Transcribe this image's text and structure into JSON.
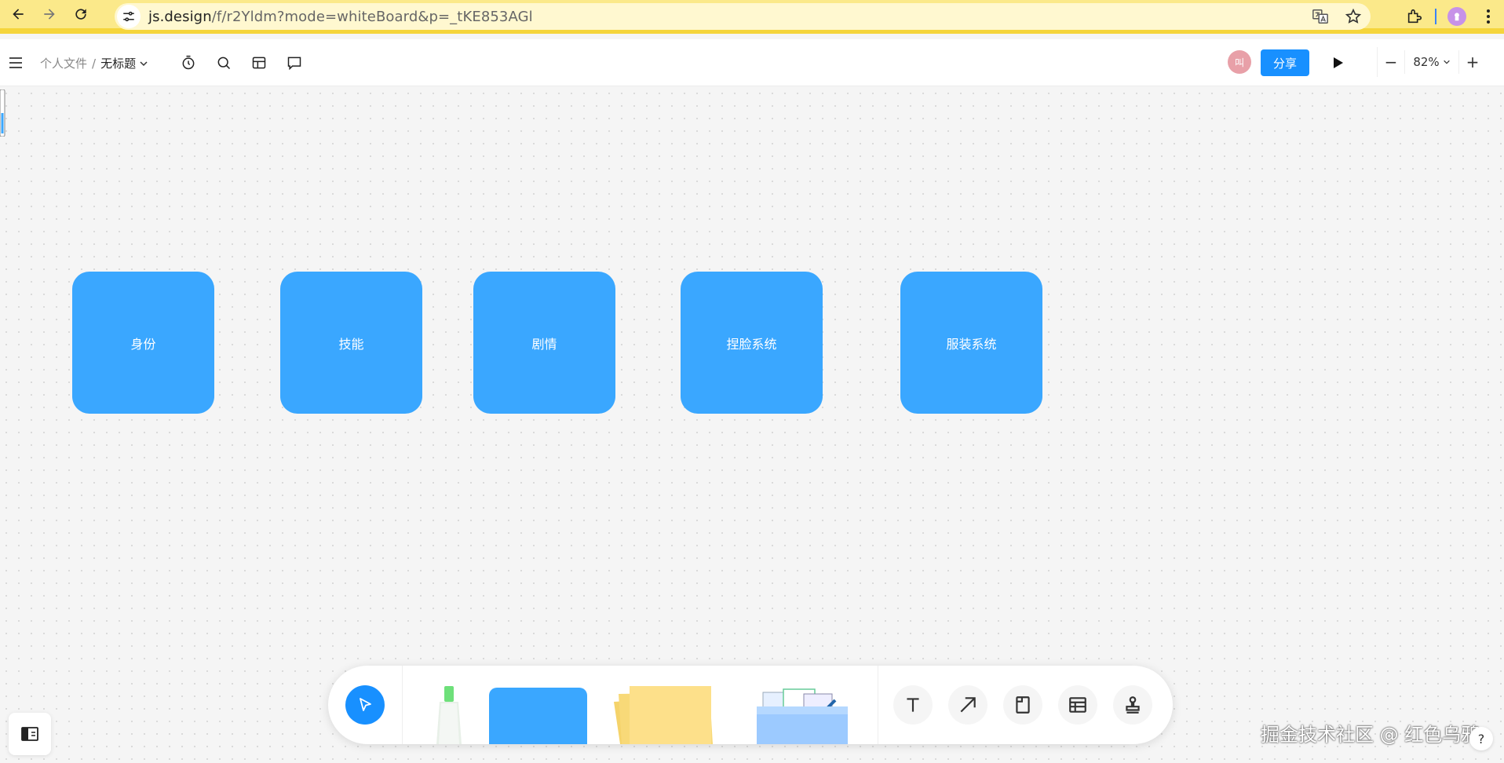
{
  "browser": {
    "url_host": "js.design",
    "url_path": "/f/r2Yldm?mode=whiteBoard&p=_tKE853AGl"
  },
  "header": {
    "breadcrumb_parent": "个人文件",
    "breadcrumb_separator": "/",
    "file_title": "无标题",
    "avatar_text": "叫",
    "share_label": "分享",
    "zoom_minus": "−",
    "zoom_value": "82%",
    "zoom_plus": "+"
  },
  "canvas": {
    "cards": [
      {
        "label": "身份"
      },
      {
        "label": "技能"
      },
      {
        "label": "剧情"
      },
      {
        "label": "捏脸系统"
      },
      {
        "label": "服装系统"
      }
    ],
    "card_color": "#3aa7ff"
  },
  "toolbar": {
    "tools": [
      {
        "name": "text-tool",
        "icon": "text-icon"
      },
      {
        "name": "arrow-tool",
        "icon": "arrow-icon"
      },
      {
        "name": "frame-tool",
        "icon": "frame-icon"
      },
      {
        "name": "table-tool",
        "icon": "table-icon"
      },
      {
        "name": "stamp-tool",
        "icon": "stamp-icon"
      }
    ]
  },
  "watermark": "掘金技术社区 @ 红色乌鸦",
  "help_label": "?",
  "colors": {
    "browser_bar": "#fbe98a",
    "accent": "#1890ff",
    "card": "#3aa7ff"
  }
}
